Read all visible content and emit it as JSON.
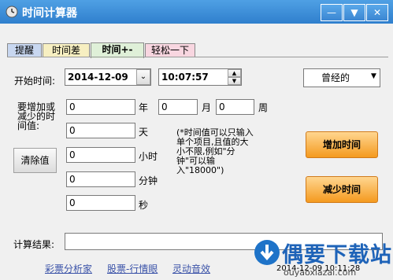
{
  "window": {
    "title": "时间计算器",
    "controls": [
      "—",
      "▼",
      "✕"
    ]
  },
  "tabs": [
    {
      "label": "提醒",
      "color": "#c8d7f0"
    },
    {
      "label": "时间差",
      "color": "#f7efc1"
    },
    {
      "label": "时间+-",
      "color": "#dff0d8"
    },
    {
      "label": "轻松一下",
      "color": "#f8d6e0"
    }
  ],
  "active_tab": "时间+-",
  "form": {
    "start_label": "开始时间:",
    "date_value": "2014-12-09",
    "time_value": "10:07:57",
    "mode_value": "曾经的",
    "add_prompt": "要增加或减少的时间值:",
    "year_value": "0",
    "year_label": "年",
    "month_value": "0",
    "month_label": "月",
    "week_value": "0",
    "week_label": "周",
    "day_value": "0",
    "day_label": "天",
    "hour_value": "0",
    "hour_label": "小时",
    "minute_value": "0",
    "minute_label": "分钟",
    "second_value": "0",
    "second_label": "秒",
    "clear_label": "清除值",
    "note": "(*时间值可以只输入单个项目,且值的大小不限,例如\"分钟\"可以输入\"18000\")",
    "add_button": "增加时间",
    "sub_button": "减少时间",
    "result_label": "计算结果:",
    "result_value": ""
  },
  "footer": {
    "links": [
      "彩票分析家",
      "股票-行情眼",
      "灵动音效"
    ],
    "clock": "2014-12-09 10:11:28"
  },
  "watermark": {
    "text": "偶要下载站",
    "domain": "ouyaoxiazai.com"
  }
}
